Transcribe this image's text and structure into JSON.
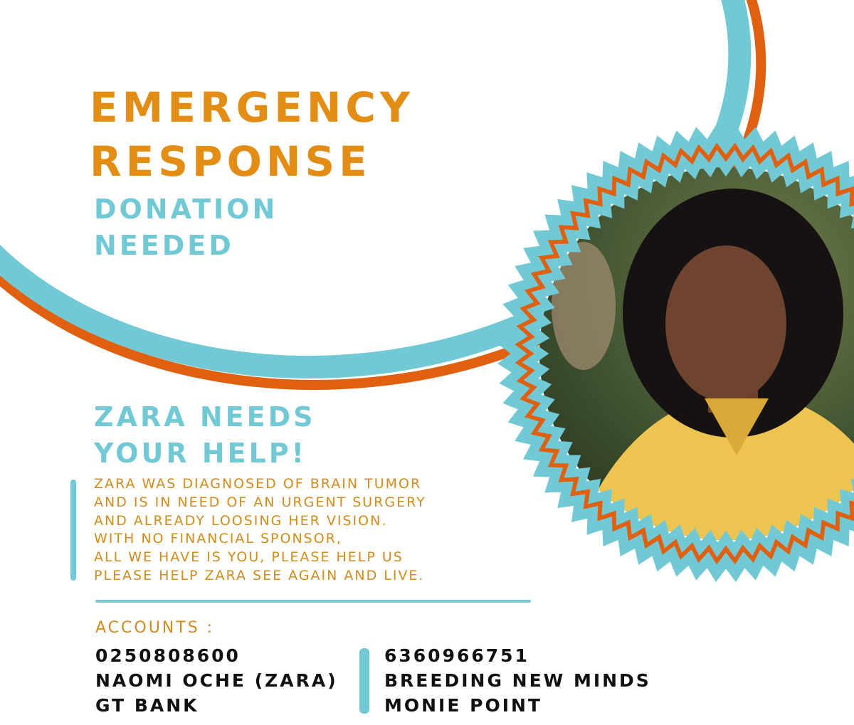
{
  "headline": {
    "line1": "EMERGENCY",
    "line2": "RESPONSE"
  },
  "subheadline": {
    "line1": "DONATION",
    "line2": "NEEDED"
  },
  "appeal": {
    "title_line1": "ZARA NEEDS",
    "title_line2": "YOUR HELP!",
    "body": [
      "ZARA WAS DIAGNOSED OF BRAIN TUMOR",
      "AND IS IN NEED OF AN URGENT SURGERY",
      "AND ALREADY LOOSING HER VISION.",
      "WITH NO FINANCIAL SPONSOR,",
      "ALL WE HAVE IS YOU, PLEASE HELP US",
      "PLEASE HELP ZARA SEE AGAIN AND LIVE."
    ]
  },
  "accounts": {
    "label": "ACCOUNTS :",
    "items": [
      {
        "number": "0250808600",
        "name": "NAOMI OCHE (ZARA)",
        "bank": "GT BANK"
      },
      {
        "number": "6360966751",
        "name": "BREEDING NEW MINDS",
        "bank": "MONIE POINT"
      }
    ]
  },
  "colors": {
    "orange": "#e38d14",
    "teal": "#72c9d6",
    "deep_orange": "#e0600f",
    "text_gold": "#d38b1c"
  }
}
